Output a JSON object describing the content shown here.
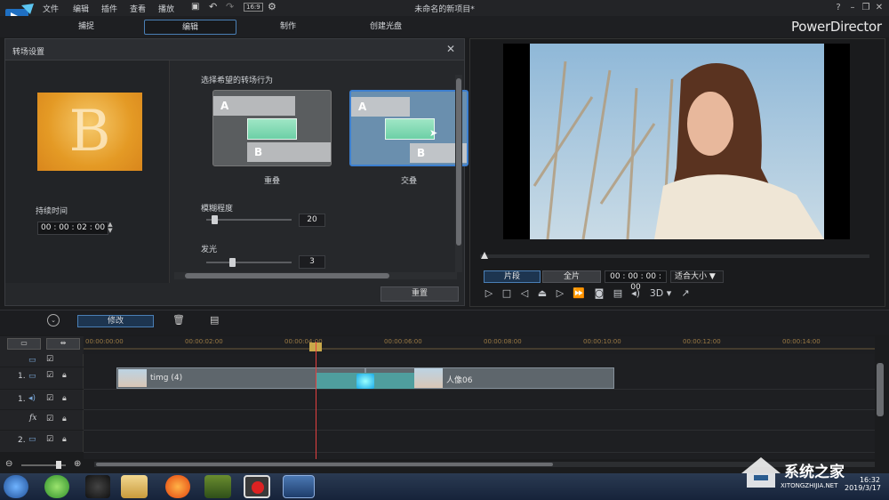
{
  "window": {
    "title": "未命名的新项目*",
    "brand": "PowerDirector"
  },
  "menu": [
    "文件",
    "编辑",
    "插件",
    "查看",
    "播放"
  ],
  "mode_tabs": [
    "捕捉",
    "编辑",
    "制作",
    "创建光盘"
  ],
  "panel": {
    "title": "转场设置",
    "duration_label": "持续时间",
    "duration_value": "00 : 00 : 02 : 00",
    "behavior_label": "选择希望的转场行为",
    "option_overlap": "重叠",
    "option_crossover": "交叠",
    "blur_label": "模糊程度",
    "blur_value": "20",
    "glow_label": "发光",
    "glow_value": "3",
    "reset_label": "重置",
    "thumb_letter": "B",
    "bar_a": "A",
    "bar_b": "B"
  },
  "preview": {
    "clip_label": "片段",
    "movie_label": "全片",
    "timecode": "00 : 00 : 00 : 00",
    "fit_label": "适合大小",
    "mode_3d": "3D"
  },
  "timeline": {
    "modify_label": "修改",
    "ruler": [
      "00:00:00:00",
      "00:00:02:00",
      "00:00:04:00",
      "00:00:06:00",
      "00:00:08:00",
      "00:00:10:00",
      "00:00:12:00",
      "00:00:14:00"
    ],
    "track_labels": [
      "1.",
      "1.",
      "2."
    ],
    "fx_label": "fx",
    "clip1": "timg (4)",
    "clip2": "人像06"
  },
  "taskbar": {
    "time": "16:32",
    "date": "2019/3/17"
  },
  "watermark": {
    "brand": "系统之家",
    "url": "XITONGZHIJIA.NET"
  },
  "colors": {
    "accent": "#4a7fb5",
    "playhead": "#e34040"
  }
}
